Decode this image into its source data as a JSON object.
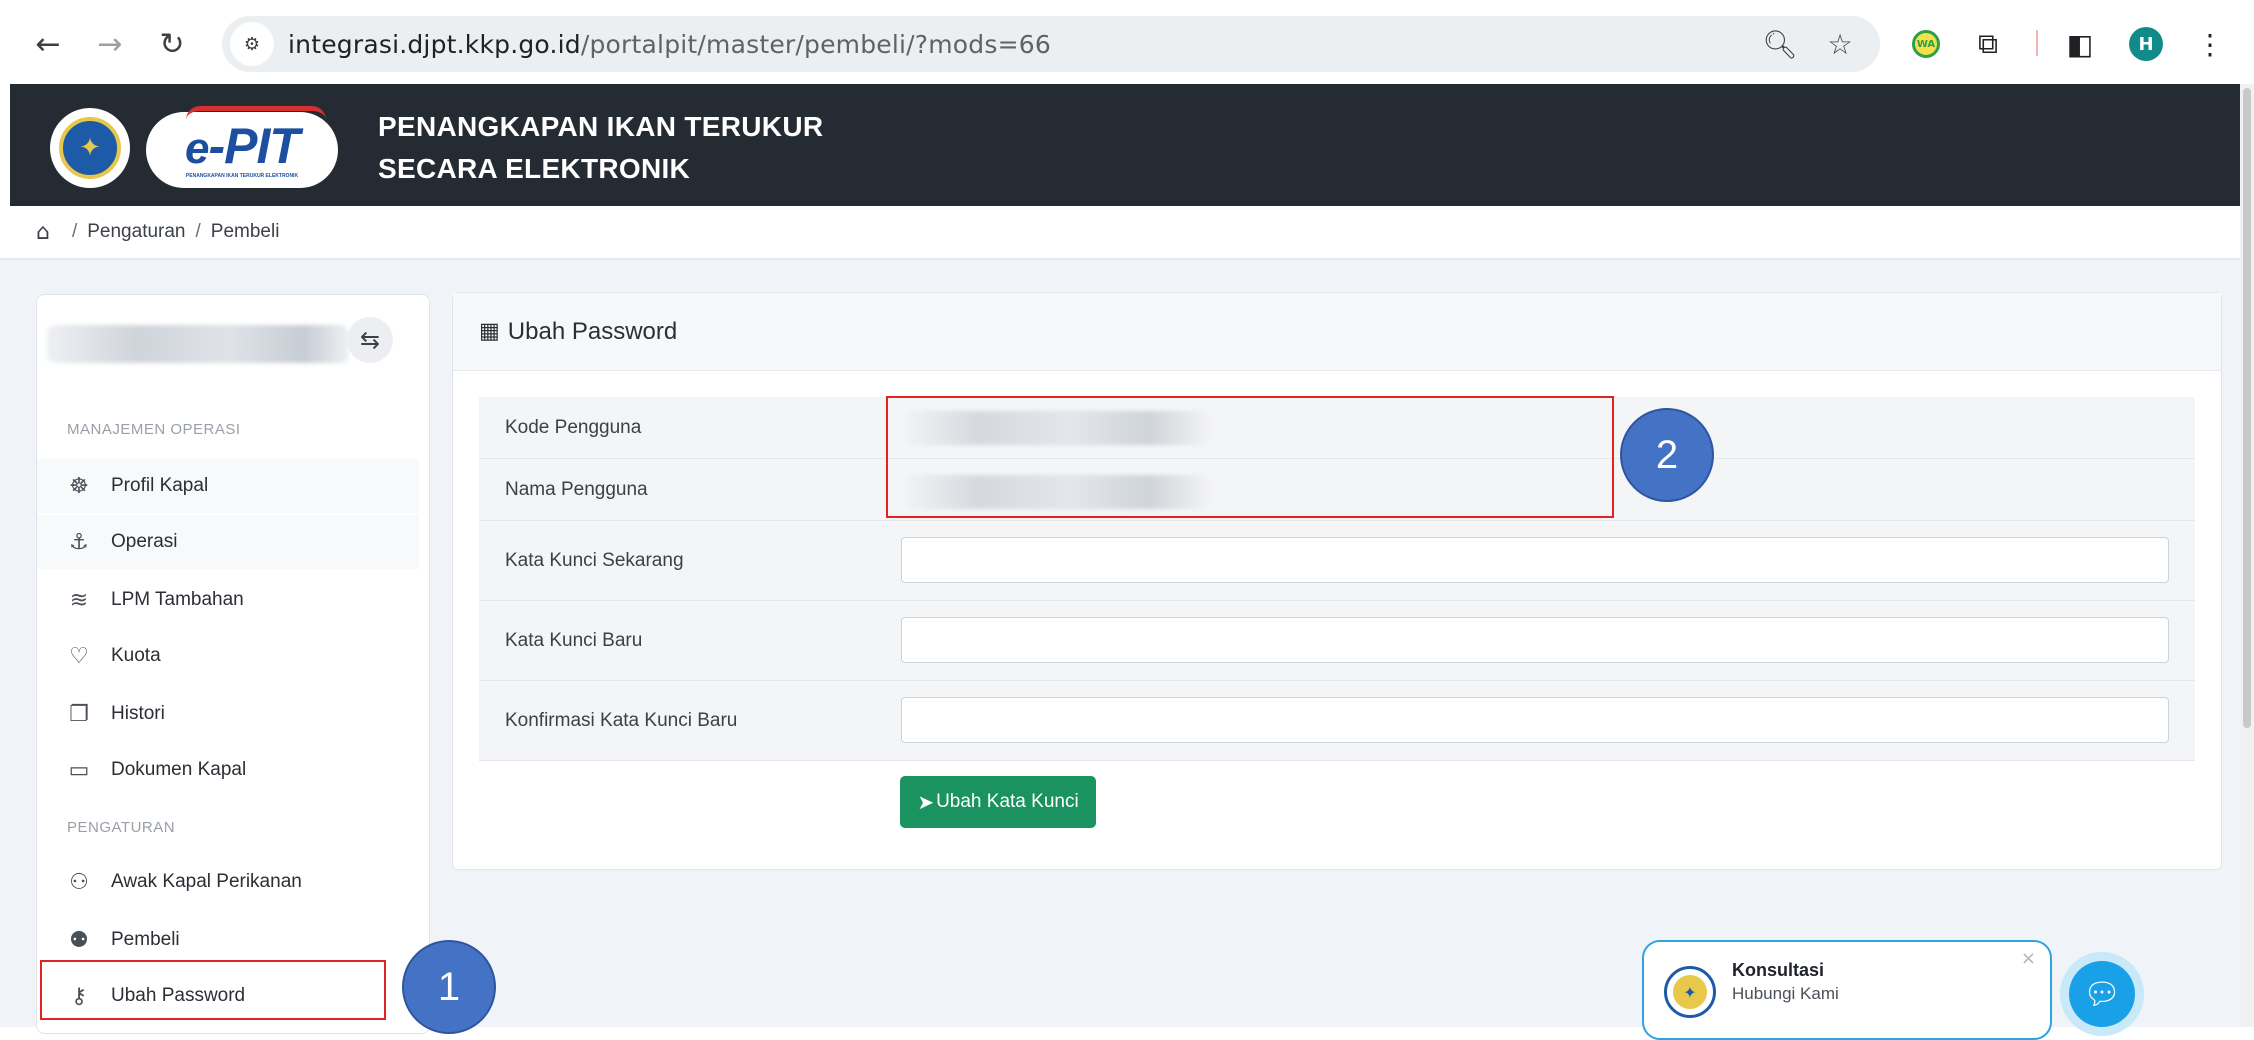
{
  "browser": {
    "url_domain": "integrasi.djpt.kkp.go.id",
    "url_path": "/portalpit/master/pembeli/?mods=66",
    "profile_initial": "H",
    "wa_badge": "WA"
  },
  "header": {
    "logo_text": "-PIT",
    "logo_prefix": "e",
    "logo_subtext": "PENANGKAPAN IKAN TERUKUR ELEKTRONIK",
    "title_line1": "PENANGKAPAN IKAN TERUKUR",
    "title_line2": "SECARA ELEKTRONIK"
  },
  "breadcrumb": {
    "items": [
      "Pengaturan",
      "Pembeli"
    ]
  },
  "sidebar": {
    "section_operasi": "MANAJEMEN OPERASI",
    "section_pengaturan": "PENGATURAN",
    "items": [
      {
        "label": "Profil Kapal",
        "icon": "ship-wheel-icon"
      },
      {
        "label": "Operasi",
        "icon": "anchor-icon"
      },
      {
        "label": "LPM Tambahan",
        "icon": "layers-icon"
      },
      {
        "label": "Kuota",
        "icon": "heart-pulse-icon"
      },
      {
        "label": "Histori",
        "icon": "copy-icon"
      },
      {
        "label": "Dokumen Kapal",
        "icon": "archive-icon"
      },
      {
        "label": "Awak Kapal Perikanan",
        "icon": "users-group-icon"
      },
      {
        "label": "Pembeli",
        "icon": "users-icon"
      },
      {
        "label": "Ubah Password",
        "icon": "key-icon"
      }
    ]
  },
  "card": {
    "title": "Ubah Password",
    "fields": {
      "kode_pengguna": "Kode Pengguna",
      "nama_pengguna": "Nama Pengguna",
      "kata_kunci_sekarang": "Kata Kunci Sekarang",
      "kata_kunci_baru": "Kata Kunci Baru",
      "konfirmasi": "Konfirmasi Kata Kunci Baru"
    },
    "submit_label": "Ubah Kata Kunci"
  },
  "callouts": {
    "first": "1",
    "second": "2"
  },
  "consult": {
    "title": "Konsultasi",
    "subtitle": "Hubungi Kami"
  },
  "colors": {
    "header_bg": "#252b33",
    "submit_green": "#1a9360",
    "callout_blue": "#4472c4",
    "highlight_red": "#e02424"
  }
}
